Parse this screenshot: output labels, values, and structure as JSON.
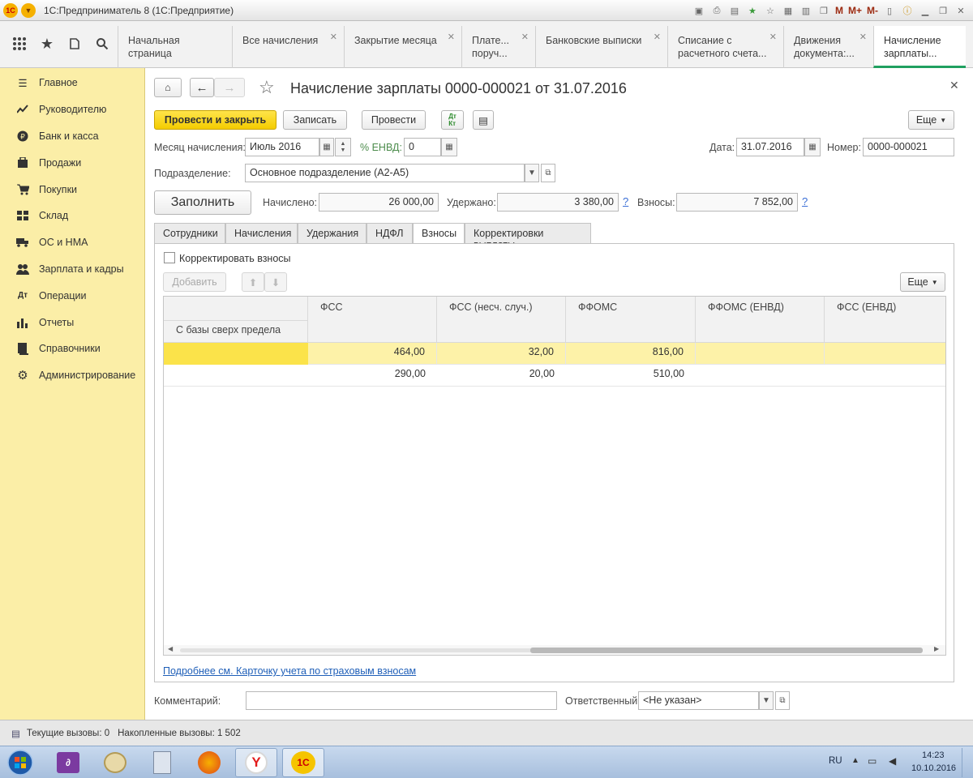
{
  "window": {
    "title": "1С:Предприниматель 8  (1С:Предприятие)"
  },
  "open_tabs": [
    {
      "label": "Начальная страница",
      "closable": false
    },
    {
      "label": "Все начисления",
      "closable": true
    },
    {
      "label": "Закрытие месяца",
      "closable": true
    },
    {
      "label": "Плате... поруч...",
      "closable": true
    },
    {
      "label": "Банковские выписки",
      "closable": true
    },
    {
      "label": "Списание с расчетного счета...",
      "closable": true
    },
    {
      "label": "Движения документа:...",
      "closable": true
    },
    {
      "label": "Начисление зарплаты...",
      "closable": false
    }
  ],
  "sidebar": {
    "items": [
      {
        "label": "Главное",
        "icon": "menu-icon"
      },
      {
        "label": "Руководителю",
        "icon": "trend-icon"
      },
      {
        "label": "Банк и касса",
        "icon": "ruble-icon"
      },
      {
        "label": "Продажи",
        "icon": "cart-icon"
      },
      {
        "label": "Покупки",
        "icon": "basket-icon"
      },
      {
        "label": "Склад",
        "icon": "warehouse-icon"
      },
      {
        "label": "ОС и НМА",
        "icon": "truck-icon"
      },
      {
        "label": "Зарплата и кадры",
        "icon": "people-icon"
      },
      {
        "label": "Операции",
        "icon": "dt-kt-icon"
      },
      {
        "label": "Отчеты",
        "icon": "bar-chart-icon"
      },
      {
        "label": "Справочники",
        "icon": "book-icon"
      },
      {
        "label": "Администрирование",
        "icon": "gear-icon"
      }
    ]
  },
  "document": {
    "title": "Начисление зарплаты 0000-000021 от 31.07.2016",
    "toolbar": {
      "post_close": "Провести и закрыть",
      "save": "Записать",
      "post": "Провести",
      "more": "Еще"
    },
    "month_label": "Месяц начисления:",
    "month_value": "Июль 2016",
    "envd_label": "% ЕНВД:",
    "envd_value": "0",
    "date_label": "Дата:",
    "date_value": "31.07.2016",
    "number_label": "Номер:",
    "number_value": "0000-000021",
    "dept_label": "Подразделение:",
    "dept_value": "Основное подразделение (А2-А5)",
    "fill_button": "Заполнить",
    "accrued_label": "Начислено:",
    "accrued_value": "26 000,00",
    "withheld_label": "Удержано:",
    "withheld_value": "3 380,00",
    "contrib_label": "Взносы:",
    "contrib_value": "7 852,00",
    "help": "?",
    "tabs": [
      "Сотрудники",
      "Начисления",
      "Удержания",
      "НДФЛ",
      "Взносы",
      "Корректировки выплаты"
    ],
    "active_tab": "Взносы",
    "correct_checkbox": "Корректировать взносы",
    "add_button": "Добавить",
    "table_more": "Еще",
    "columns": [
      "ФСС",
      "ФСС (несч. случ.)",
      "ФФОМС",
      "ФФОМС (ЕНВД)",
      "ФСС (ЕНВД)"
    ],
    "left_header": "С базы сверх предела",
    "rows": [
      [
        "464,00",
        "32,00",
        "816,00",
        "",
        ""
      ],
      [
        "290,00",
        "20,00",
        "510,00",
        "",
        ""
      ]
    ],
    "link": "Подробнее см. Карточку учета по страховым взносам",
    "comment_label": "Комментарий:",
    "comment_value": "",
    "responsible_label": "Ответственный:",
    "responsible_value": "<Не указан>"
  },
  "status": {
    "current_calls": "Текущие вызовы: 0",
    "accumulated_calls": "Накопленные вызовы: 1 502"
  },
  "taskbar": {
    "lang": "RU",
    "time": "14:23",
    "date": "10.10.2016"
  },
  "colors": {
    "sidebar": "#fbeea7",
    "accent_yellow": "#f4cc00",
    "selected_row": "#fdf2a8"
  }
}
